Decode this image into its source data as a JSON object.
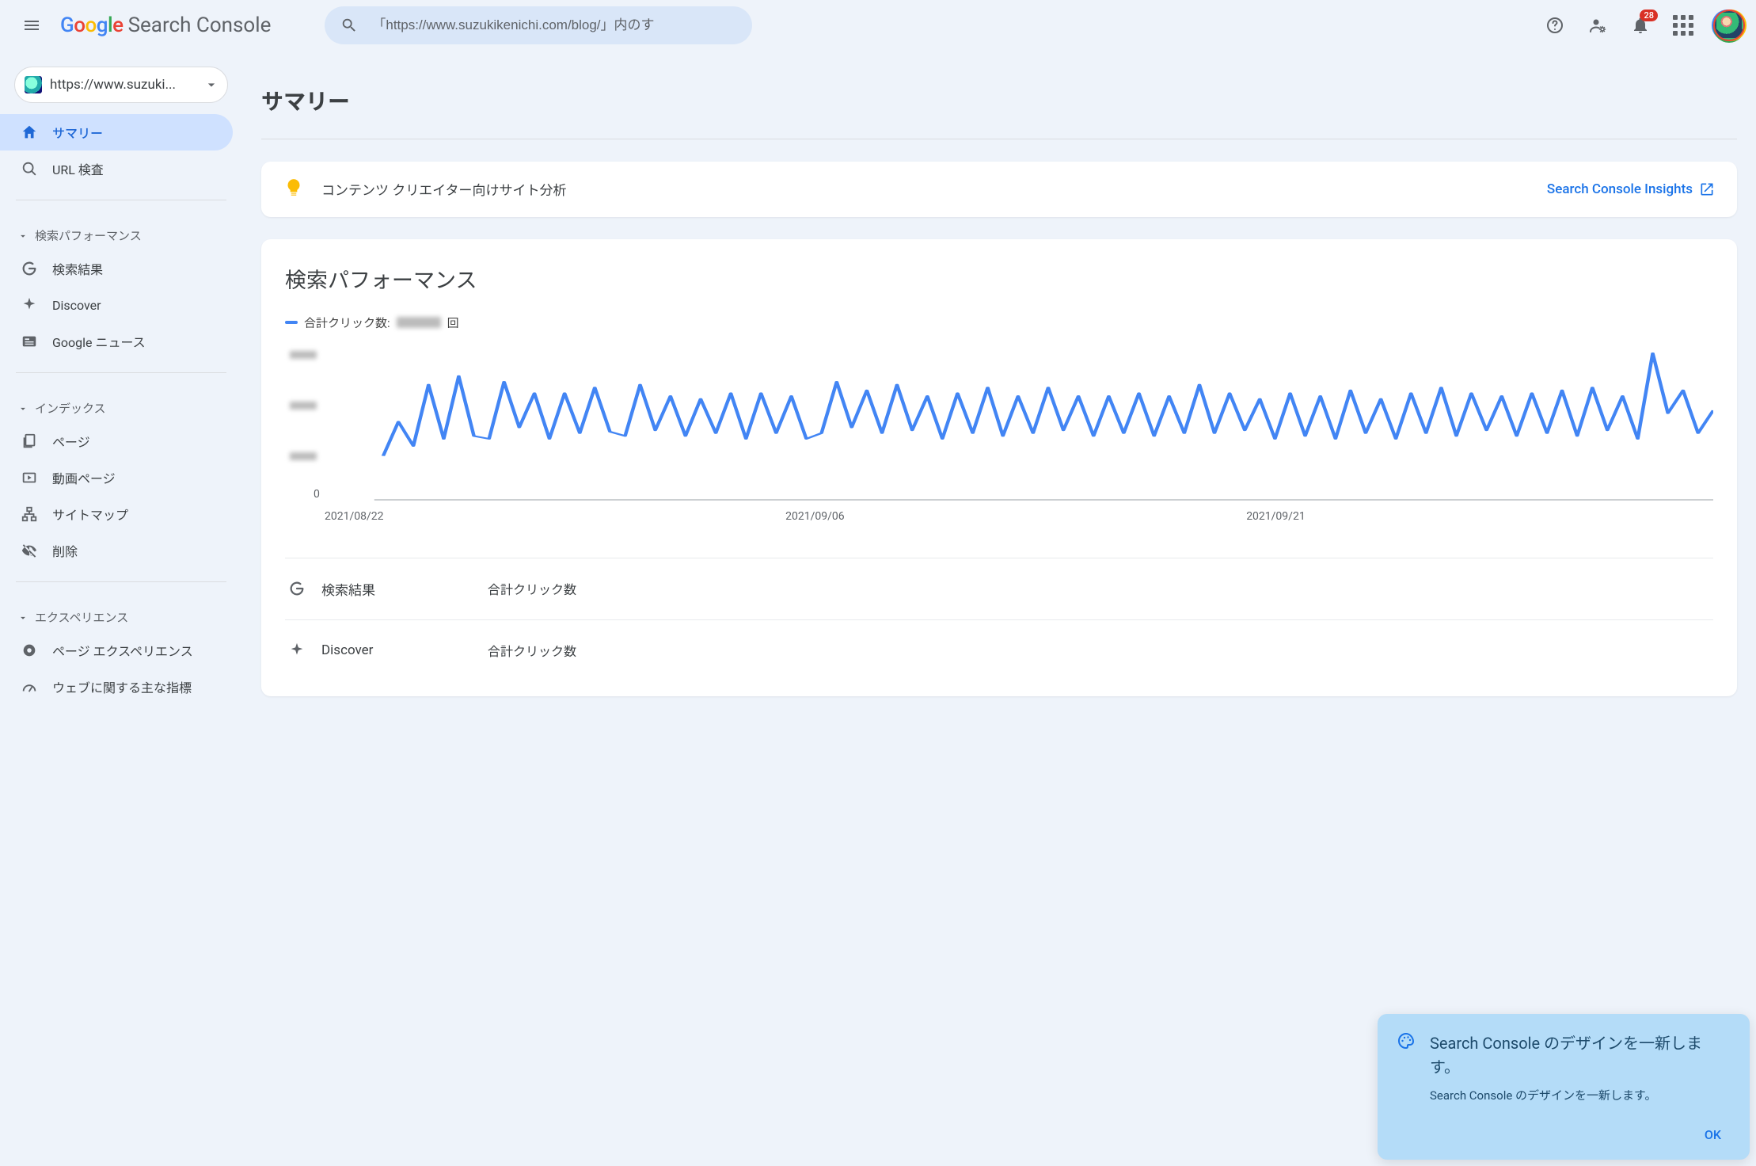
{
  "header": {
    "product_name": "Search Console",
    "search_placeholder": "「https://www.suzukikenichi.com/blog/」内のす",
    "notification_count": "28"
  },
  "property": {
    "url": "https://www.suzuki..."
  },
  "nav": {
    "summary": "サマリー",
    "url_inspection": "URL 検査",
    "group_perf": "検索パフォーマンス",
    "search_results": "検索結果",
    "discover": "Discover",
    "google_news": "Google ニュース",
    "group_index": "インデックス",
    "pages": "ページ",
    "video_pages": "動画ページ",
    "sitemaps": "サイトマップ",
    "removals": "削除",
    "group_experience": "エクスペリエンス",
    "page_experience": "ページ エクスペリエンス",
    "core_web_vitals": "ウェブに関する主な指標"
  },
  "page": {
    "title": "サマリー"
  },
  "insights": {
    "text": "コンテンツ クリエイター向けサイト分析",
    "link": "Search Console Insights"
  },
  "perf": {
    "title": "検索パフォーマンス",
    "legend_label": "合計クリック数:",
    "legend_unit": "回",
    "row_search_label": "検索結果",
    "row_search_metric": "合計クリック数",
    "row_discover_label": "Discover",
    "row_discover_metric": "合計クリック数"
  },
  "chart_data": {
    "type": "line",
    "title": "検索パフォーマンス",
    "xlabel": "",
    "ylabel": "",
    "categories": [
      "2021/08/22",
      "2021/09/06",
      "2021/09/21"
    ],
    "ylim": [
      0,
      null
    ],
    "note": "y-axis tick values and total click count are redacted/blurred in the screenshot",
    "series": [
      {
        "name": "合計クリック数",
        "values": [
          28,
          52,
          35,
          78,
          40,
          84,
          42,
          40,
          80,
          48,
          72,
          40,
          72,
          44,
          76,
          45,
          42,
          78,
          46,
          70,
          42,
          68,
          44,
          72,
          40,
          72,
          44,
          70,
          40,
          44,
          80,
          48,
          74,
          44,
          78,
          46,
          70,
          40,
          72,
          44,
          76,
          42,
          70,
          44,
          76,
          46,
          70,
          42,
          70,
          44,
          72,
          42,
          70,
          44,
          78,
          44,
          72,
          46,
          68,
          40,
          72,
          42,
          70,
          40,
          74,
          44,
          68,
          40,
          72,
          44,
          76,
          42,
          72,
          46,
          70,
          42,
          72,
          44,
          74,
          42,
          76,
          46,
          70,
          40,
          100,
          58,
          74,
          44,
          60
        ]
      }
    ]
  },
  "toast": {
    "title": "Search Console のデザインを一新します。",
    "subtitle": "Search Console のデザインを一新します。",
    "ok": "OK"
  }
}
